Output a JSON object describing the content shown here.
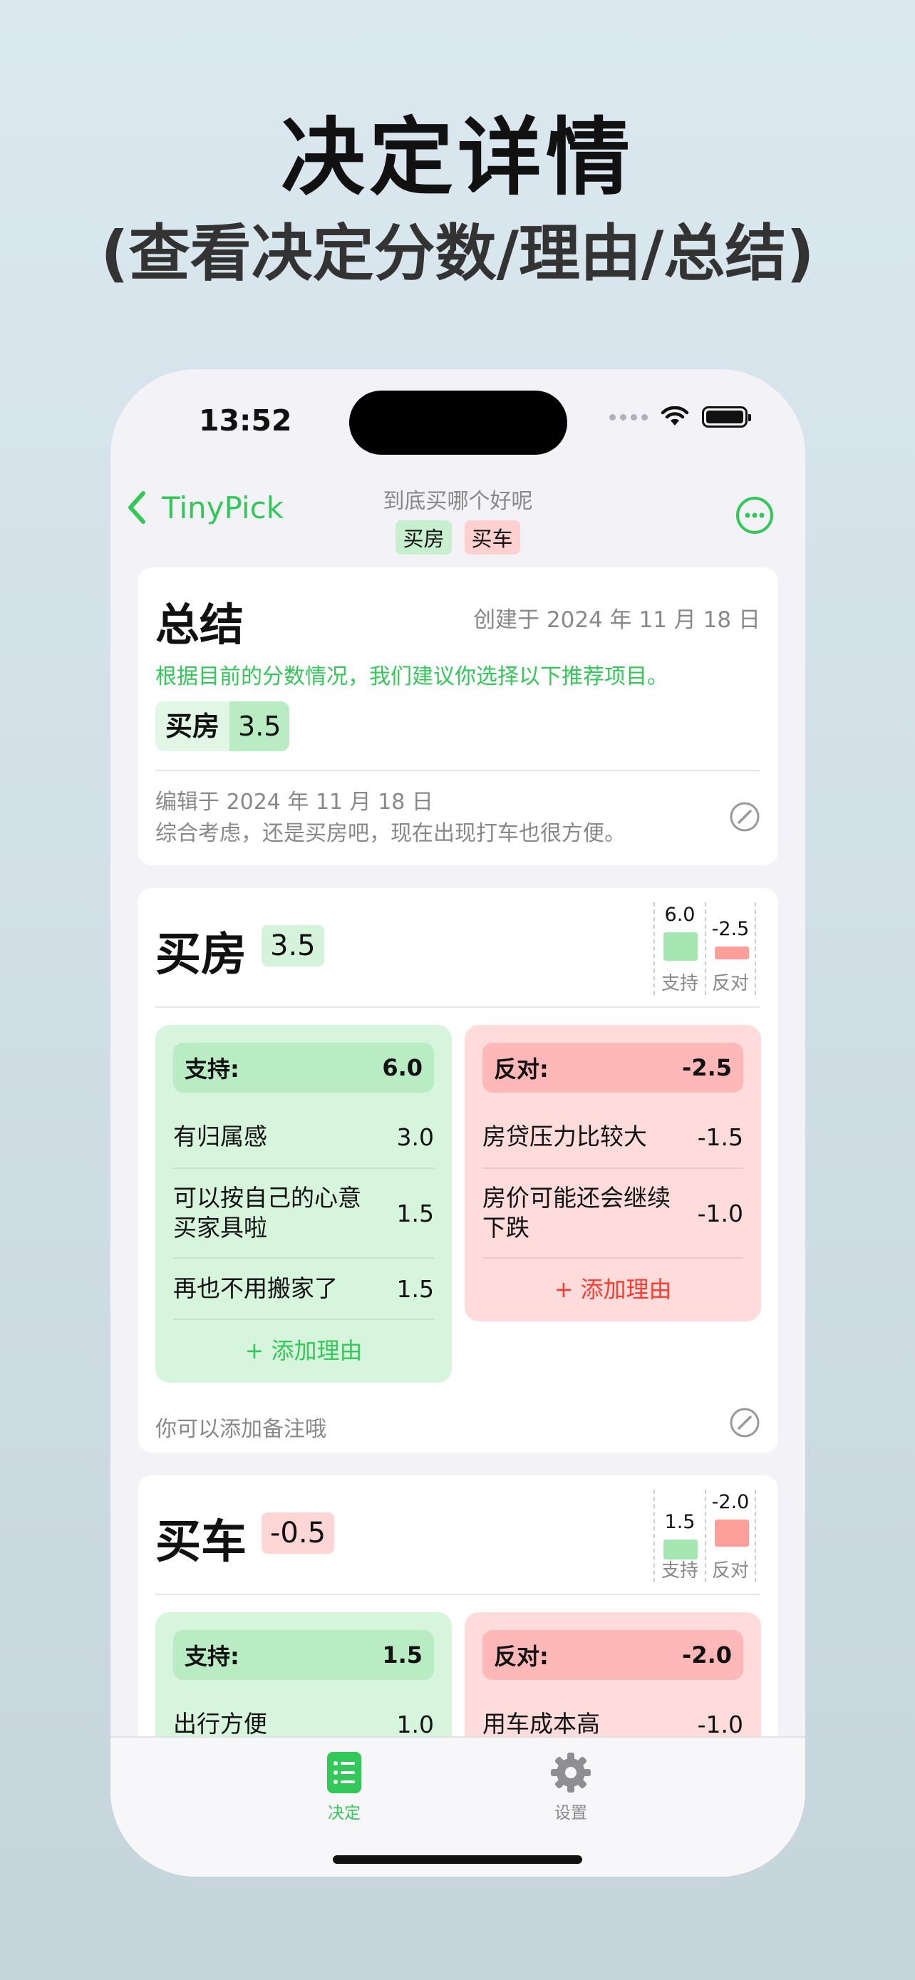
{
  "promo": {
    "headline": "决定详情",
    "subheadline": "(查看决定分数/理由/总结)"
  },
  "status_bar": {
    "time": "13:52"
  },
  "nav": {
    "back_label": "TinyPick",
    "title": "到底买哪个好呢",
    "tags": [
      "买房",
      "买车"
    ]
  },
  "summary": {
    "title": "总结",
    "created": "创建于 2024 年 11 月 18 日",
    "recommendation": "根据目前的分数情况，我们建议你选择以下推荐项目。",
    "rec_name": "买房",
    "rec_score": "3.5",
    "edited": "编辑于 2024 年 11 月 18 日",
    "comment": "综合考虑，还是买房吧，现在出现打车也很方便。"
  },
  "options": [
    {
      "name": "买房",
      "score": "3.5",
      "chart": {
        "pro_value": "6.0",
        "con_value": "-2.5",
        "pro_label": "支持",
        "con_label": "反对"
      },
      "pros": {
        "label": "支持:",
        "total": "6.0",
        "items": [
          {
            "text": "有归属感",
            "value": "3.0"
          },
          {
            "text": "可以按自己的心意买家具啦",
            "value": "1.5"
          },
          {
            "text": "再也不用搬家了",
            "value": "1.5"
          }
        ],
        "add": "+ 添加理由"
      },
      "cons": {
        "label": "反对:",
        "total": "-2.5",
        "items": [
          {
            "text": "房贷压力比较大",
            "value": "-1.5"
          },
          {
            "text": "房价可能还会继续下跌",
            "value": "-1.0"
          }
        ],
        "add": "+ 添加理由"
      },
      "note_placeholder": "你可以添加备注哦"
    },
    {
      "name": "买车",
      "score": "-0.5",
      "chart": {
        "pro_value": "1.5",
        "con_value": "-2.0",
        "pro_label": "支持",
        "con_label": "反对"
      },
      "pros": {
        "label": "支持:",
        "total": "1.5",
        "items": [
          {
            "text": "出行方便",
            "value": "1.0"
          }
        ]
      },
      "cons": {
        "label": "反对:",
        "total": "-2.0",
        "items": [
          {
            "text": "用车成本高",
            "value": "-1.0"
          }
        ]
      }
    }
  ],
  "tabbar": {
    "tabs": [
      "决定",
      "设置"
    ]
  },
  "colors": {
    "accent": "#34c759",
    "pro_bg": "#d6f5dc",
    "con_bg": "#ffdcdc",
    "pro_bar": "#a6e6b3",
    "con_bar": "#ff9f9a"
  }
}
